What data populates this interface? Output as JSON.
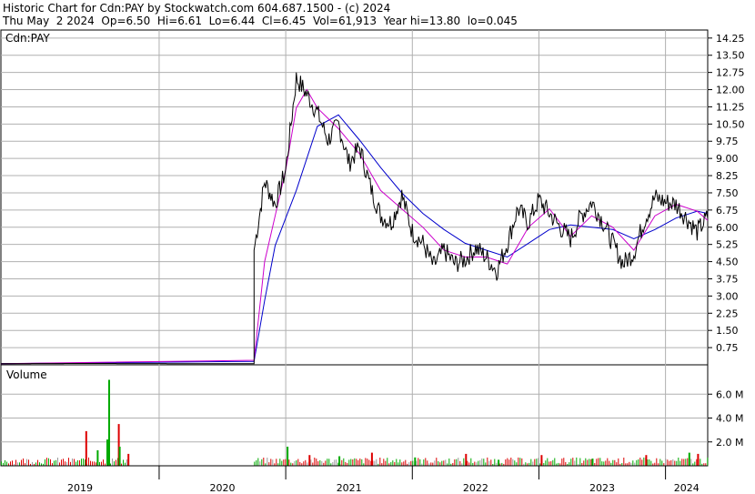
{
  "header": {
    "line1": "Historic Chart for Cdn:PAY by Stockwatch.com 604.687.1500 - (c) 2024",
    "line2": "Thu May  2 2024  Op=6.50  Hi=6.61  Lo=6.44  Cl=6.45  Vol=61,913  Year hi=13.80  lo=0.045"
  },
  "colors": {
    "price": "#000000",
    "ma_short": "#cc00cc",
    "ma_long": "#0000cc",
    "vol_up": "#00aa00",
    "vol_down": "#dd0000",
    "vol_neutral": "#999999",
    "grid": "#b0b0b0"
  },
  "chart_data": [
    {
      "type": "line",
      "title": "Cdn:PAY",
      "ylim": [
        0,
        14.6
      ],
      "yticks": [
        "0.75",
        "1.50",
        "2.25",
        "3.00",
        "3.75",
        "4.50",
        "5.25",
        "6.00",
        "6.75",
        "7.50",
        "8.25",
        "9.00",
        "9.75",
        "10.50",
        "11.25",
        "12.00",
        "12.75",
        "13.50",
        "14.25"
      ],
      "x_range": [
        "2018-10",
        "2024-05"
      ],
      "series": [
        {
          "key": "price",
          "x": [
            "2018-10",
            "2019-06",
            "2020-06",
            "2020-10",
            "2020-10",
            "2020-11",
            "2020-12",
            "2021-01",
            "2021-02",
            "2021-03",
            "2021-04",
            "2021-05",
            "2021-06",
            "2021-07",
            "2021-08",
            "2021-09",
            "2021-10",
            "2021-11",
            "2021-12",
            "2022-01",
            "2022-02",
            "2022-03",
            "2022-04",
            "2022-05",
            "2022-06",
            "2022-07",
            "2022-08",
            "2022-09",
            "2022-10",
            "2022-11",
            "2022-12",
            "2023-01",
            "2023-02",
            "2023-03",
            "2023-04",
            "2023-05",
            "2023-06",
            "2023-07",
            "2023-08",
            "2023-09",
            "2023-10",
            "2023-11",
            "2023-12",
            "2024-01",
            "2024-02",
            "2024-03",
            "2024-04",
            "2024-05"
          ],
          "values": [
            0.05,
            0.06,
            0.05,
            0.05,
            5.0,
            8.0,
            7.0,
            8.5,
            12.5,
            11.8,
            11.0,
            9.8,
            10.5,
            8.8,
            9.5,
            7.8,
            6.5,
            6.2,
            7.4,
            5.8,
            5.3,
            4.3,
            5.0,
            4.4,
            4.6,
            5.1,
            4.7,
            4.1,
            5.3,
            6.8,
            6.2,
            7.2,
            6.6,
            6.0,
            5.5,
            6.5,
            7.1,
            6.3,
            5.3,
            4.4,
            4.9,
            6.3,
            7.3,
            7.1,
            7.0,
            6.4,
            5.8,
            6.45
          ]
        },
        {
          "key": "ma_short",
          "x": [
            "2018-10",
            "2020-10",
            "2020-11",
            "2020-12",
            "2021-01",
            "2021-02",
            "2021-03",
            "2021-04",
            "2021-06",
            "2021-08",
            "2021-10",
            "2021-12",
            "2022-02",
            "2022-04",
            "2022-06",
            "2022-08",
            "2022-10",
            "2022-12",
            "2023-02",
            "2023-04",
            "2023-06",
            "2023-08",
            "2023-10",
            "2023-12",
            "2024-02",
            "2024-04",
            "2024-05"
          ],
          "values": [
            0.05,
            0.2,
            4.5,
            6.5,
            8.5,
            11.2,
            12.0,
            11.2,
            10.3,
            9.2,
            7.6,
            6.8,
            6.0,
            5.0,
            4.7,
            4.7,
            4.4,
            6.0,
            6.8,
            5.6,
            6.5,
            6.0,
            5.0,
            6.5,
            7.0,
            6.7,
            6.3
          ]
        },
        {
          "key": "ma_long",
          "x": [
            "2018-10",
            "2020-10",
            "2020-11",
            "2020-12",
            "2021-02",
            "2021-04",
            "2021-06",
            "2021-08",
            "2021-10",
            "2021-12",
            "2022-02",
            "2022-04",
            "2022-06",
            "2022-08",
            "2022-10",
            "2022-12",
            "2023-02",
            "2023-04",
            "2023-06",
            "2023-08",
            "2023-10",
            "2023-12",
            "2024-02",
            "2024-04",
            "2024-05"
          ],
          "values": [
            0.05,
            0.15,
            2.8,
            5.2,
            7.6,
            10.4,
            10.9,
            9.8,
            8.6,
            7.5,
            6.6,
            5.9,
            5.3,
            5.0,
            4.7,
            5.3,
            5.9,
            6.1,
            6.0,
            5.9,
            5.5,
            5.9,
            6.4,
            6.7,
            6.6
          ]
        }
      ]
    },
    {
      "type": "bar",
      "title": "Volume",
      "ylim": [
        0,
        8.0
      ],
      "yticks": [
        "2.0 M",
        "4.0 M",
        "6.0 M"
      ],
      "x_range": [
        "2018-10",
        "2024-05"
      ],
      "series": [
        {
          "name": "Volume",
          "x": [
            "2019-06",
            "2019-07",
            "2019-08",
            "2019-08",
            "2019-09",
            "2019-09",
            "2019-10",
            "2021-01",
            "2021-03",
            "2021-06",
            "2021-09",
            "2022-01",
            "2022-06",
            "2022-09",
            "2023-01",
            "2023-06",
            "2023-11",
            "2024-03",
            "2024-04"
          ],
          "values": [
            2.9,
            1.3,
            7.2,
            2.2,
            3.5,
            1.6,
            1.0,
            1.6,
            0.9,
            0.8,
            1.1,
            0.7,
            1.0,
            0.5,
            0.9,
            0.6,
            0.9,
            1.1,
            1.0
          ]
        }
      ]
    }
  ],
  "x_axis": {
    "years": [
      "2019",
      "2020",
      "2021",
      "2022",
      "2023",
      "2024"
    ]
  }
}
